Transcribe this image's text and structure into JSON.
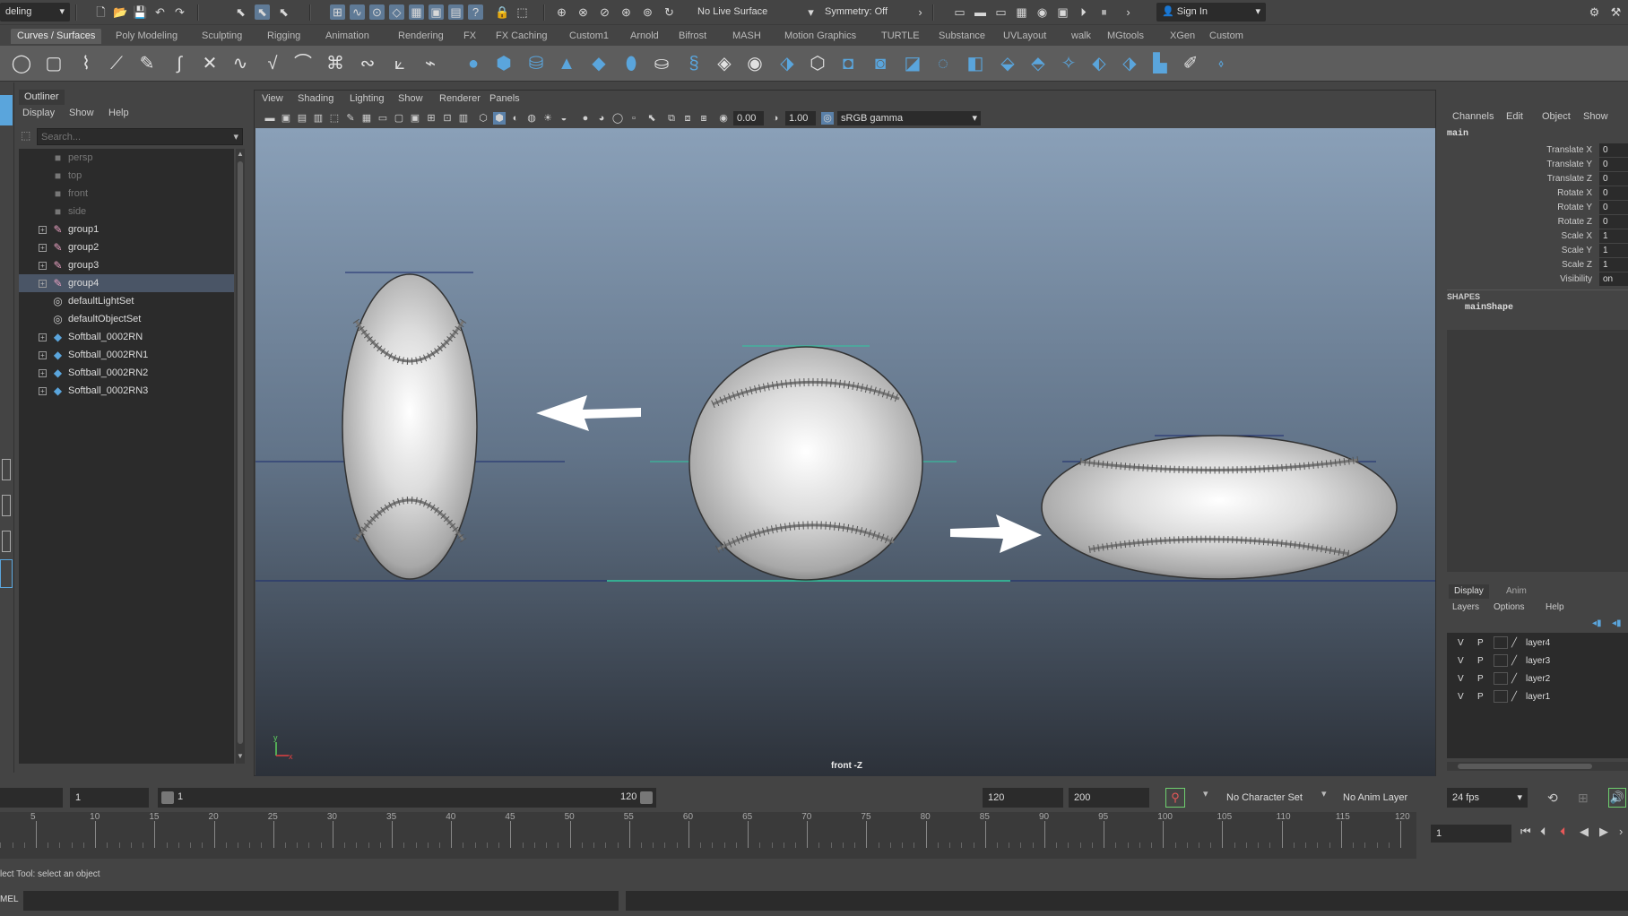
{
  "status_line": {
    "mode_menu": "deling",
    "live_surface": "No Live Surface",
    "symmetry": "Symmetry: Off",
    "sign_in": "Sign In"
  },
  "shelf_tabs": [
    "Curves / Surfaces",
    "Poly Modeling",
    "Sculpting",
    "Rigging",
    "Animation",
    "Rendering",
    "FX",
    "FX Caching",
    "Custom1",
    "Arnold",
    "Bifrost",
    "MASH",
    "Motion Graphics",
    "TURTLE",
    "Substance",
    "UVLayout",
    "walk",
    "MGtools",
    "XGen",
    "Custom"
  ],
  "outliner": {
    "title": "Outliner",
    "menus": [
      "Display",
      "Show",
      "Help"
    ],
    "search_placeholder": "Search...",
    "items": [
      {
        "label": "persp",
        "icon": "camera-icon",
        "dim": true
      },
      {
        "label": "top",
        "icon": "camera-icon",
        "dim": true
      },
      {
        "label": "front",
        "icon": "camera-icon",
        "dim": true
      },
      {
        "label": "side",
        "icon": "camera-icon",
        "dim": true
      },
      {
        "label": "group1",
        "icon": "group-icon",
        "expand": true
      },
      {
        "label": "group2",
        "icon": "group-icon",
        "expand": true
      },
      {
        "label": "group3",
        "icon": "group-icon",
        "expand": true
      },
      {
        "label": "group4",
        "icon": "group-icon",
        "expand": true,
        "selected": true
      },
      {
        "label": "defaultLightSet",
        "icon": "set-icon"
      },
      {
        "label": "defaultObjectSet",
        "icon": "set-icon"
      },
      {
        "label": "Softball_0002RN",
        "icon": "reference-icon",
        "expand": true
      },
      {
        "label": "Softball_0002RN1",
        "icon": "reference-icon",
        "expand": true
      },
      {
        "label": "Softball_0002RN2",
        "icon": "reference-icon",
        "expand": true
      },
      {
        "label": "Softball_0002RN3",
        "icon": "reference-icon",
        "expand": true
      }
    ]
  },
  "viewport": {
    "menus": [
      "View",
      "Shading",
      "Lighting",
      "Show",
      "Renderer",
      "Panels"
    ],
    "exposure": "0.00",
    "gamma": "1.00",
    "color_space": "sRGB gamma",
    "camera_label": "front -Z",
    "axis_y": "y",
    "axis_x": "x"
  },
  "channel_box": {
    "menus": [
      "Channels",
      "Edit",
      "Object",
      "Show"
    ],
    "object": "main",
    "attributes": [
      {
        "name": "Translate X",
        "value": "0"
      },
      {
        "name": "Translate Y",
        "value": "0"
      },
      {
        "name": "Translate Z",
        "value": "0"
      },
      {
        "name": "Rotate X",
        "value": "0"
      },
      {
        "name": "Rotate Y",
        "value": "0"
      },
      {
        "name": "Rotate Z",
        "value": "0"
      },
      {
        "name": "Scale X",
        "value": "1"
      },
      {
        "name": "Scale Y",
        "value": "1"
      },
      {
        "name": "Scale Z",
        "value": "1"
      },
      {
        "name": "Visibility",
        "value": "on"
      }
    ],
    "shapes_header": "SHAPES",
    "shape": "mainShape"
  },
  "layer_editor": {
    "tabs": [
      "Display",
      "Anim"
    ],
    "menus": [
      "Layers",
      "Options",
      "Help"
    ],
    "layers": [
      {
        "v": "V",
        "p": "P",
        "name": "layer4"
      },
      {
        "v": "V",
        "p": "P",
        "name": "layer3"
      },
      {
        "v": "V",
        "p": "P",
        "name": "layer2"
      },
      {
        "v": "V",
        "p": "P",
        "name": "layer1"
      }
    ]
  },
  "range": {
    "current_frame": "1",
    "range_start": "1",
    "range_end": "120",
    "anim_end": "120",
    "max_end": "200",
    "character_set": "No Character Set",
    "anim_layer": "No Anim Layer",
    "fps": "24 fps"
  },
  "time_slider": {
    "ticks": [
      "5",
      "10",
      "15",
      "20",
      "25",
      "30",
      "35",
      "40",
      "45",
      "50",
      "55",
      "60",
      "65",
      "70",
      "75",
      "80",
      "85",
      "90",
      "95",
      "100",
      "105",
      "110",
      "115",
      "120"
    ],
    "current_frame_field": "1"
  },
  "help_line": "lect Tool: select an object",
  "command_line": {
    "label": "MEL"
  },
  "colors": {
    "panel": "#444444",
    "field": "#2b2b2b",
    "selection": "#4a5566",
    "accent_blue": "#5aa5dc"
  }
}
